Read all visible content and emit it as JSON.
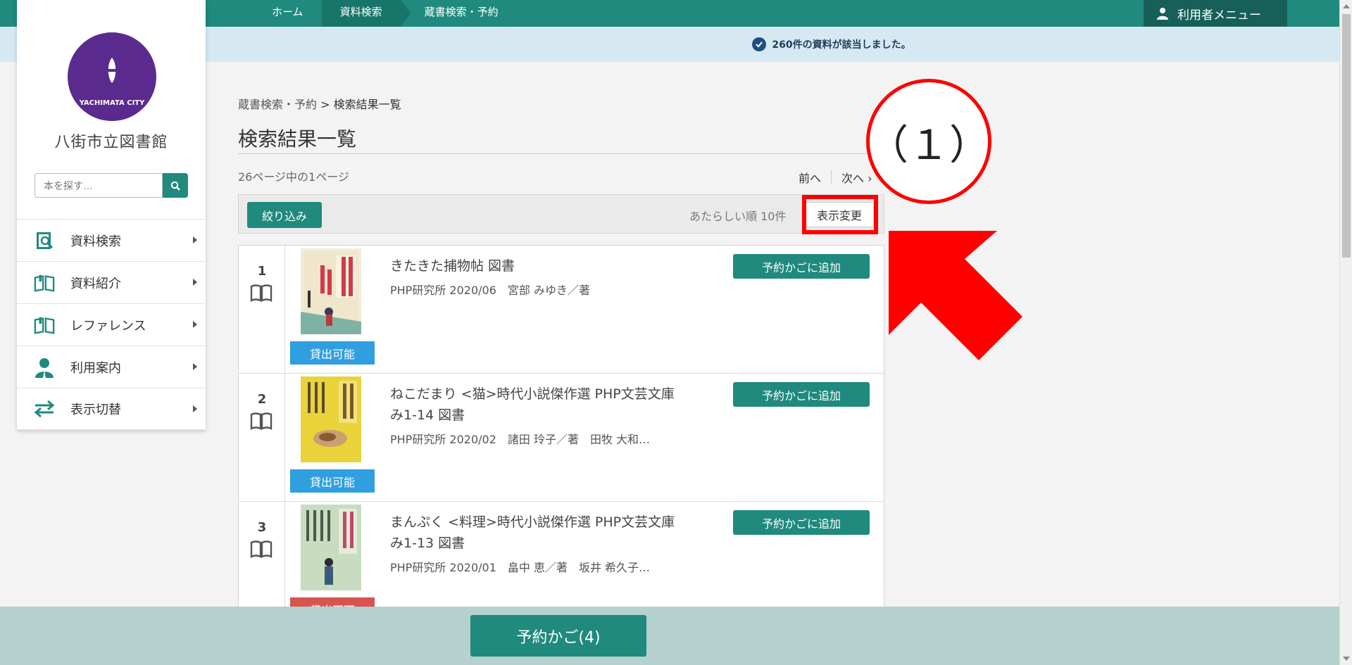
{
  "nav": {
    "crumbs": [
      "ホーム",
      "資料検索",
      "蔵書検索・予約"
    ],
    "user_menu": "利用者メニュー"
  },
  "notice": {
    "text": "260件の資料が該当しました。"
  },
  "sidebar": {
    "logo_text": "YACHIMATA CITY",
    "library_name": "八街市立図書館",
    "search_placeholder": "本を探す…",
    "items": [
      {
        "label": "資料検索",
        "icon": "book-search-icon"
      },
      {
        "label": "資料紹介",
        "icon": "open-book-icon"
      },
      {
        "label": "レファレンス",
        "icon": "open-book-icon"
      },
      {
        "label": "利用案内",
        "icon": "person-icon"
      },
      {
        "label": "表示切替",
        "icon": "switch-arrows-icon"
      }
    ]
  },
  "main": {
    "breadcrumb_link": "蔵書検索・予約",
    "breadcrumb_sep": ">",
    "breadcrumb_current": "検索結果一覧",
    "title": "検索結果一覧",
    "page_count": "26ページ中の1ページ",
    "prev": "前へ",
    "next": "次へ ›",
    "filter_label": "絞り込み",
    "sort_text": "あたらしい順 10件",
    "display_change": "表示変更",
    "results": [
      {
        "num": "1",
        "title": "きたきた捕物帖 図書",
        "meta": "PHP研究所 2020/06　宮部 みゆき／著",
        "status": "貸出可能",
        "status_type": "ok",
        "reserve": "予約かごに追加"
      },
      {
        "num": "2",
        "title": "ねこだまり <猫>時代小説傑作選 PHP文芸文庫 み1-14 図書",
        "meta": "PHP研究所 2020/02　諸田 玲子／著　田牧 大和…",
        "status": "貸出可能",
        "status_type": "ok",
        "reserve": "予約かごに追加"
      },
      {
        "num": "3",
        "title": "まんぷく <料理>時代小説傑作選 PHP文芸文庫 み1-13 図書",
        "meta": "PHP研究所 2020/01　畠中 恵／著　坂井 希久子…",
        "status": "貸出不可",
        "status_type": "ng",
        "reserve": "予約かごに追加"
      }
    ]
  },
  "annotation": {
    "label": "（１）",
    "color": "#ff0000"
  },
  "basket": {
    "label": "予約かご(4)"
  },
  "colors": {
    "primary": "#1f8a7d",
    "notice_bg": "#d6e9f3",
    "available": "#2f9fe0",
    "unavailable": "#d9534f"
  }
}
